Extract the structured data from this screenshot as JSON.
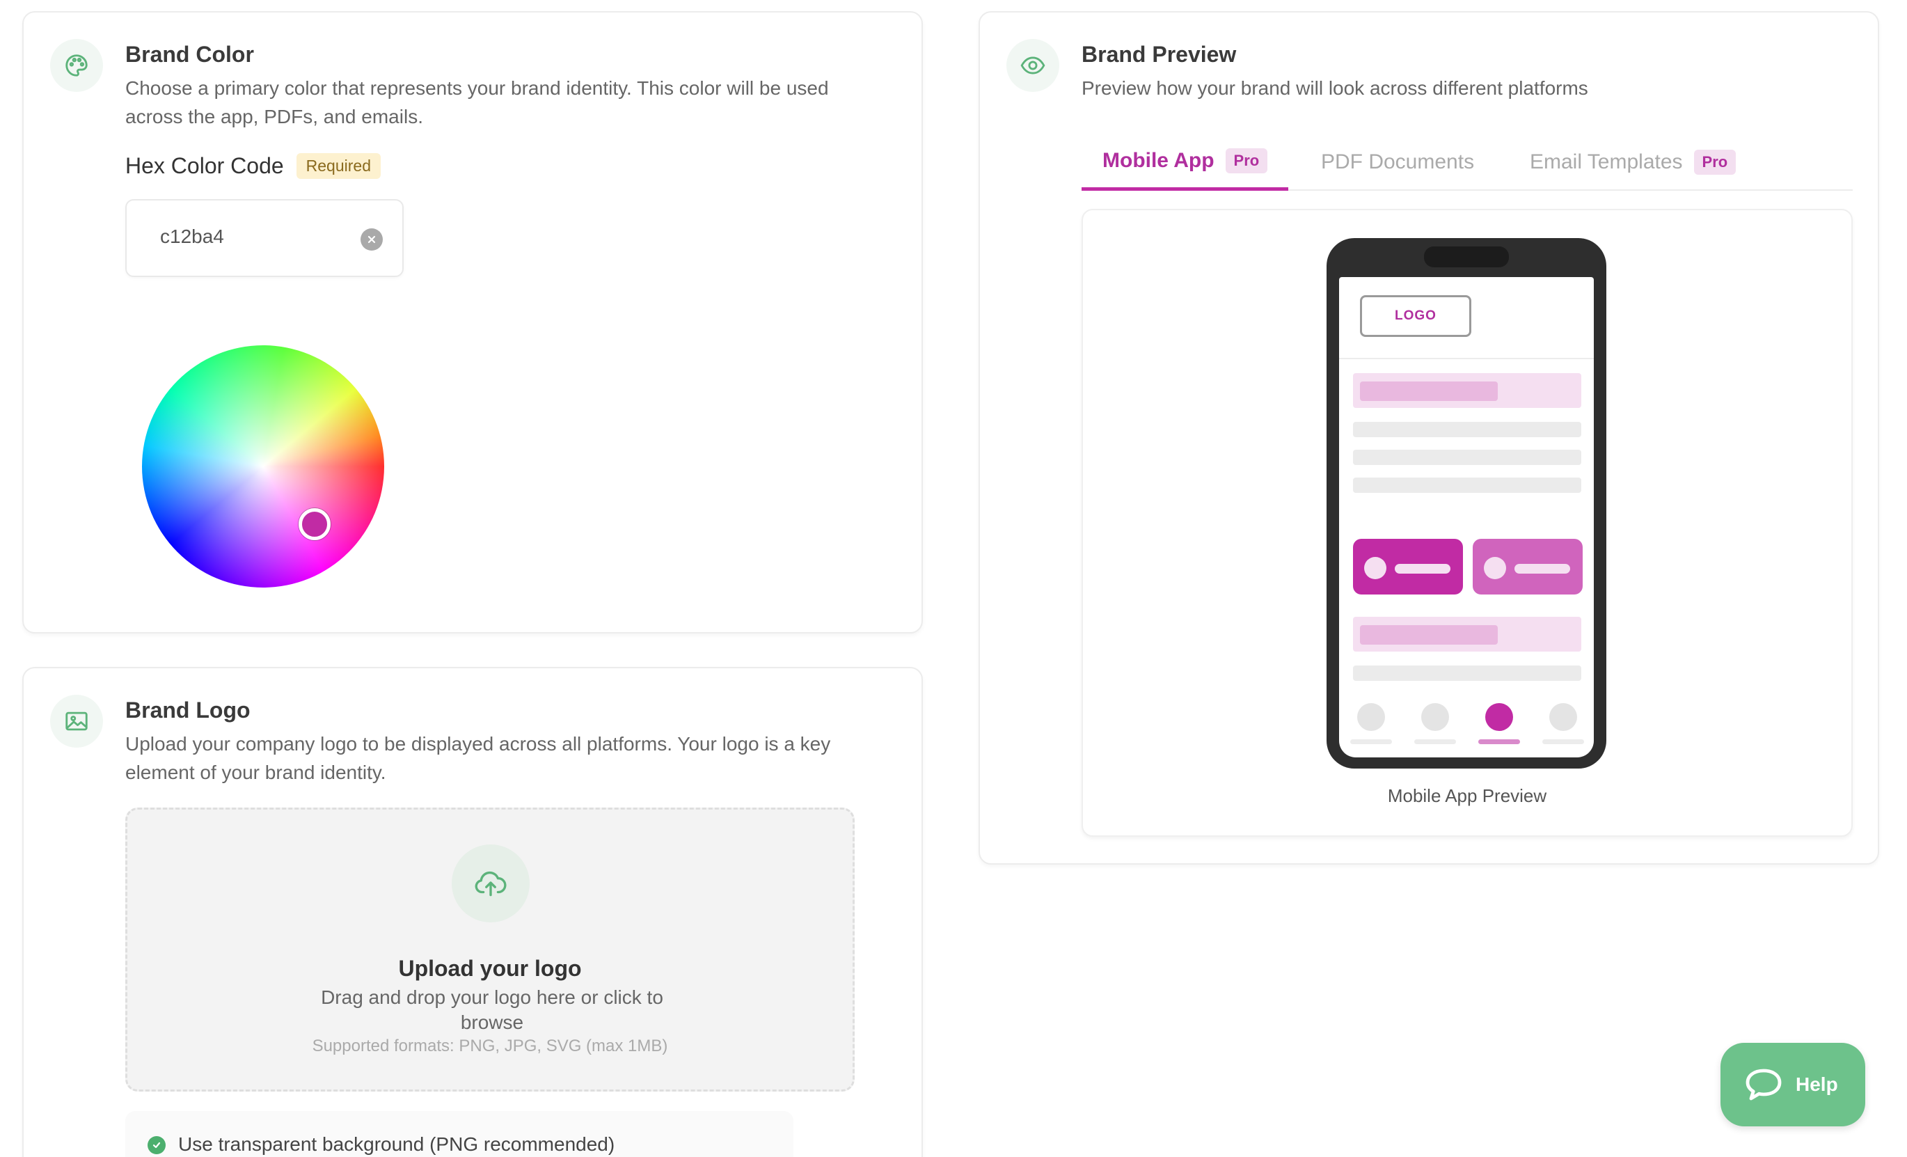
{
  "brand_color": {
    "title": "Brand Color",
    "description": "Choose a primary color that represents your brand identity. This color will be used across the app, PDFs, and emails.",
    "hex_label": "Hex Color Code",
    "required_badge": "Required",
    "hex_value": "c12ba4",
    "selected_color": "#c12ba4"
  },
  "brand_logo": {
    "title": "Brand Logo",
    "description": "Upload your company logo to be displayed across all platforms. Your logo is a key element of your brand identity.",
    "upload_title": "Upload your logo",
    "upload_desc": "Drag and drop your logo here or click to browse",
    "upload_formats": "Supported formats: PNG, JPG, SVG (max 1MB)",
    "transparent_option": "Use transparent background (PNG recommended)"
  },
  "brand_preview": {
    "title": "Brand Preview",
    "description": "Preview how your brand will look across different platforms",
    "tabs": [
      {
        "label": "Mobile App",
        "badge": "Pro",
        "active": true
      },
      {
        "label": "PDF Documents",
        "badge": "",
        "active": false
      },
      {
        "label": "Email Templates",
        "badge": "Pro",
        "active": false
      }
    ],
    "phone_logo_text": "LOGO",
    "caption": "Mobile App Preview"
  },
  "help_button": {
    "label": "Help"
  },
  "colors": {
    "accent": "#c12ba4",
    "accent_light": "#d064bd",
    "green": "#6dc28b"
  }
}
